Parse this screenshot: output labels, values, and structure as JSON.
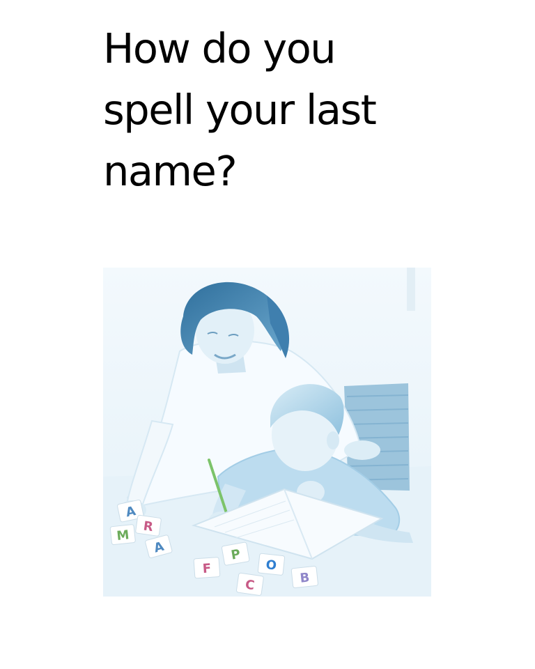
{
  "card": {
    "title": "How do you\nspell your last\nname?"
  },
  "photo": {
    "subject": "woman-helping-boy-write",
    "tint": "#5aa8d8",
    "letter_tiles": [
      "A",
      "R",
      "M",
      "P",
      "O",
      "F",
      "C",
      "B"
    ]
  }
}
